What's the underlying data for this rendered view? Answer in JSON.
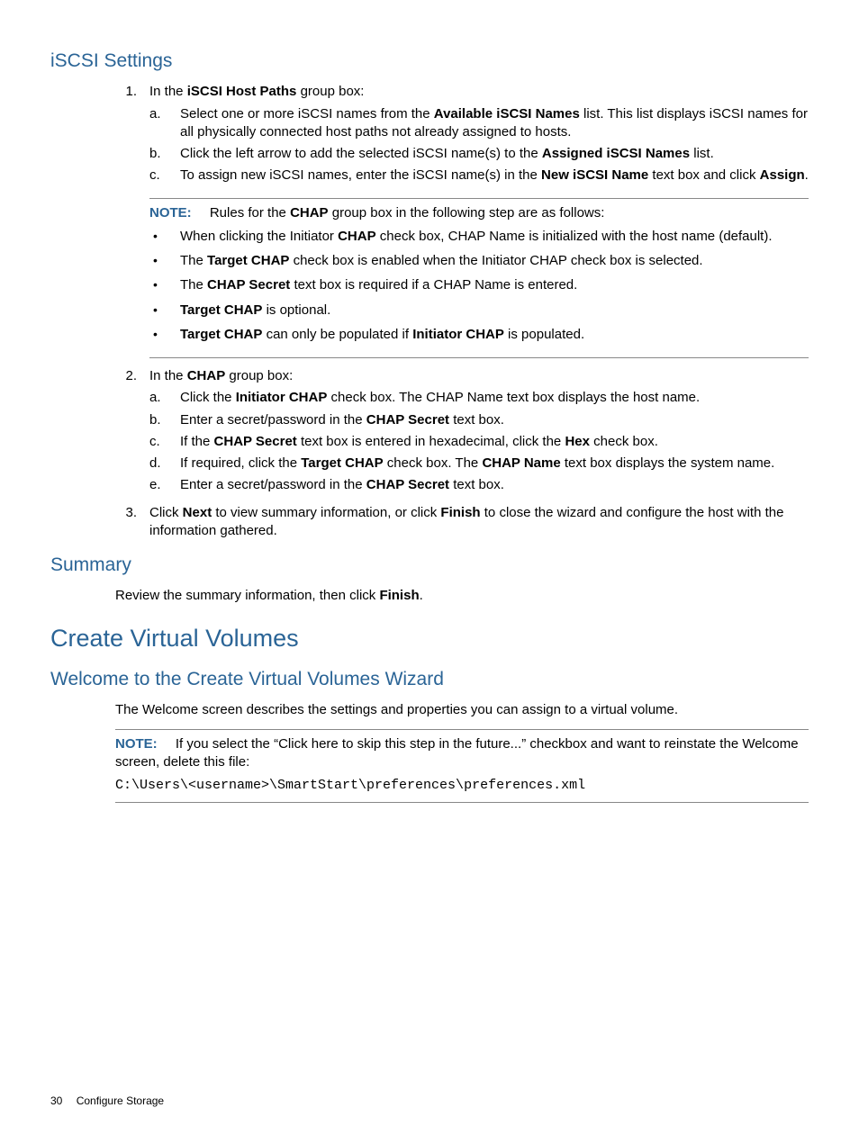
{
  "section1": {
    "heading": "iSCSI Settings",
    "ol": [
      {
        "num": "1.",
        "lead_pre": "In the ",
        "lead_bold": "iSCSI Host Paths",
        "lead_post": " group box:",
        "sub": [
          {
            "m": "a.",
            "pre": "Select one or more iSCSI names from the ",
            "b1": "Available iSCSI Names",
            "mid": " list. This list displays iSCSI names for all physically connected host paths not already assigned to hosts.",
            "b2": "",
            "post": ""
          },
          {
            "m": "b.",
            "pre": "Click the left arrow to add the selected iSCSI name(s) to the ",
            "b1": "Assigned iSCSI Names",
            "mid": " list.",
            "b2": "",
            "post": ""
          },
          {
            "m": "c.",
            "pre": "To assign new iSCSI names, enter the iSCSI name(s) in the ",
            "b1": "New iSCSI Name",
            "mid": " text box and click ",
            "b2": "Assign",
            "post": "."
          }
        ]
      },
      {
        "num": "2.",
        "lead_pre": "In the ",
        "lead_bold": "CHAP",
        "lead_post": " group box:",
        "sub": [
          {
            "m": "a.",
            "pre": "Click the ",
            "b1": "Initiator CHAP",
            "mid": " check box. The CHAP Name text box displays the host name.",
            "b2": "",
            "post": ""
          },
          {
            "m": "b.",
            "pre": "Enter a secret/password in the ",
            "b1": "CHAP Secret",
            "mid": " text box.",
            "b2": "",
            "post": ""
          },
          {
            "m": "c.",
            "pre": "If the ",
            "b1": "CHAP Secret",
            "mid": " text box is entered in hexadecimal, click the ",
            "b2": "Hex",
            "post": " check box."
          },
          {
            "m": "d.",
            "pre": "If required, click the ",
            "b1": "Target CHAP",
            "mid": " check box. The ",
            "b2": "CHAP Name",
            "post": " text box displays the system name."
          },
          {
            "m": "e.",
            "pre": "Enter a secret/password in the ",
            "b1": "CHAP Secret",
            "mid": " text box.",
            "b2": "",
            "post": ""
          }
        ]
      },
      {
        "num": "3.",
        "lead_pre": "Click ",
        "lead_bold": "Next",
        "lead_post_pre": " to view summary information, or click ",
        "lead_bold2": "Finish",
        "lead_post2": " to close the wizard and configure the host with the information gathered."
      }
    ],
    "note": {
      "label": "NOTE:",
      "lead_pre": "Rules for the ",
      "lead_bold": "CHAP",
      "lead_post": " group box in the following step are as follows:",
      "bullets": [
        {
          "pre": "When clicking the Initiator ",
          "b1": "CHAP",
          "mid": " check box, CHAP Name is initialized with the host name (default).",
          "b2": "",
          "post": ""
        },
        {
          "pre": "The ",
          "b1": "Target CHAP",
          "mid": " check box is enabled when the Initiator CHAP check box is selected.",
          "b2": "",
          "post": ""
        },
        {
          "pre": "The ",
          "b1": "CHAP Secret",
          "mid": " text box is required if a CHAP Name is entered.",
          "b2": "",
          "post": ""
        },
        {
          "pre": "",
          "b1": "Target CHAP",
          "mid": " is optional.",
          "b2": "",
          "post": ""
        },
        {
          "pre": "",
          "b1": "Target CHAP",
          "mid": " can only be populated if ",
          "b2": "Initiator CHAP",
          "post": " is populated."
        }
      ]
    }
  },
  "section2": {
    "heading": "Summary",
    "para_pre": "Review the summary information, then click ",
    "para_bold": "Finish",
    "para_post": "."
  },
  "section3": {
    "heading": "Create Virtual Volumes"
  },
  "section4": {
    "heading": "Welcome to the Create Virtual Volumes Wizard",
    "para": "The Welcome screen describes the settings and properties you can assign to a virtual volume.",
    "note": {
      "label": "NOTE:",
      "text": "If you select the “Click here to skip this step in the future...” checkbox and want to reinstate the Welcome screen, delete this file:",
      "code": "C:\\Users\\<username>\\SmartStart\\preferences\\preferences.xml"
    }
  },
  "footer": {
    "page": "30",
    "title": "Configure Storage"
  }
}
